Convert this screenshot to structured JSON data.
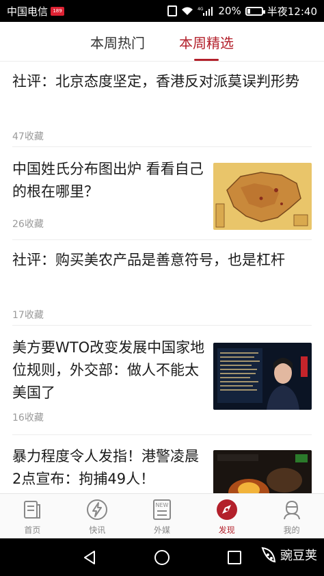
{
  "status_bar": {
    "carrier": "中国电信",
    "carrier_badge": "189",
    "network": "4G",
    "battery": "20%",
    "battery_level": 0.2,
    "time": "半夜12:40"
  },
  "tabs": [
    {
      "label": "本周热门",
      "active": false
    },
    {
      "label": "本周精选",
      "active": true
    }
  ],
  "feed": [
    {
      "title": "社评：北京态度坚定，香港反对派莫误判形势",
      "saves": "47收藏",
      "has_thumb": false
    },
    {
      "title": "中国姓氏分布图出炉 看看自己的根在哪里？",
      "saves": "26收藏",
      "has_thumb": true,
      "thumb": "china-surname-map"
    },
    {
      "title": "社评：购买美农产品是善意符号，也是杠杆",
      "saves": "17收藏",
      "has_thumb": false
    },
    {
      "title": "美方要WTO改变发展中国家地位规则，外交部：做人不能太美国了",
      "saves": "16收藏",
      "has_thumb": true,
      "thumb": "spokesperson-photo"
    },
    {
      "title": "暴力程度令人发指！港警凌晨2点宣布：拘捕49人！",
      "saves": "",
      "has_thumb": true,
      "thumb": "night-fire-photo"
    }
  ],
  "bottom_nav": [
    {
      "label": "首页",
      "icon": "home-news-icon",
      "active": false
    },
    {
      "label": "快讯",
      "icon": "lightning-icon",
      "active": false
    },
    {
      "label": "外媒",
      "icon": "new-media-icon",
      "active": false,
      "icon_text": "NEW"
    },
    {
      "label": "发现",
      "icon": "compass-icon",
      "active": true
    },
    {
      "label": "我的",
      "icon": "profile-icon",
      "active": false
    }
  ],
  "system_nav": {
    "watermark": "豌豆荚"
  },
  "colors": {
    "accent": "#b3202b",
    "text": "#1b1b1b",
    "meta": "#9a9a9a"
  }
}
